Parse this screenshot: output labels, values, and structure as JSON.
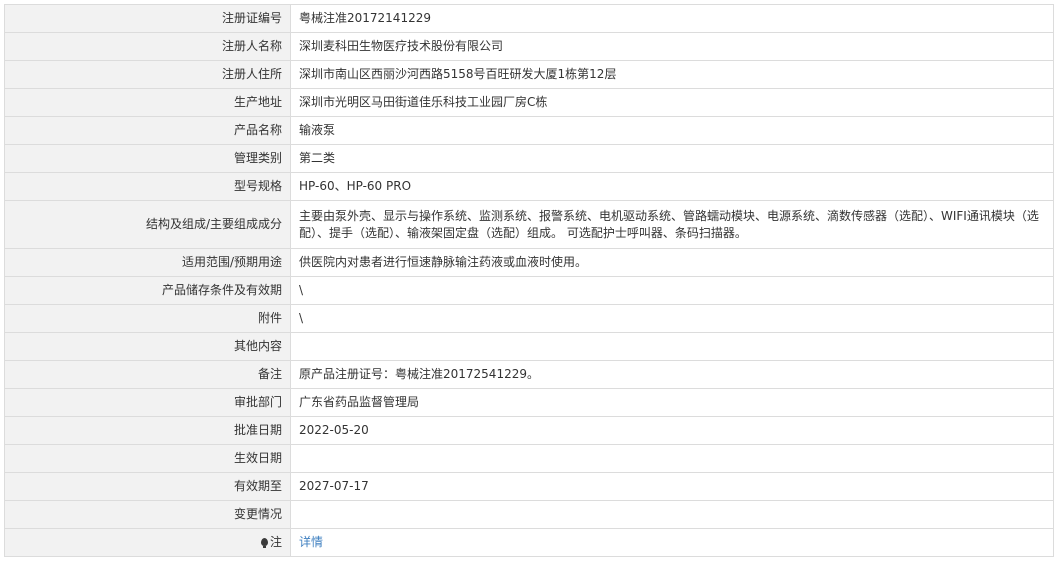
{
  "rows": [
    {
      "label": "注册证编号",
      "value": "粤械注准20172141229"
    },
    {
      "label": "注册人名称",
      "value": "深圳麦科田生物医疗技术股份有限公司"
    },
    {
      "label": "注册人住所",
      "value": "深圳市南山区西丽沙河西路5158号百旺研发大厦1栋第12层"
    },
    {
      "label": "生产地址",
      "value": "深圳市光明区马田街道佳乐科技工业园厂房C栋"
    },
    {
      "label": "产品名称",
      "value": "输液泵"
    },
    {
      "label": "管理类别",
      "value": "第二类"
    },
    {
      "label": "型号规格",
      "value": "HP-60、HP-60 PRO"
    },
    {
      "label": "结构及组成/主要组成成分",
      "value": "主要由泵外壳、显示与操作系统、监测系统、报警系统、电机驱动系统、管路蠕动模块、电源系统、滴数传感器（选配）、WIFI通讯模块（选配）、提手（选配）、输液架固定盘（选配）组成。 可选配护士呼叫器、条码扫描器。"
    },
    {
      "label": "适用范围/预期用途",
      "value": "供医院内对患者进行恒速静脉输注药液或血液时使用。"
    },
    {
      "label": "产品储存条件及有效期",
      "value": "\\"
    },
    {
      "label": "附件",
      "value": "\\"
    },
    {
      "label": "其他内容",
      "value": ""
    },
    {
      "label": "备注",
      "value": "原产品注册证号：粤械注准20172541229。"
    },
    {
      "label": "审批部门",
      "value": "广东省药品监督管理局"
    },
    {
      "label": "批准日期",
      "value": "2022-05-20"
    },
    {
      "label": "生效日期",
      "value": ""
    },
    {
      "label": "有效期至",
      "value": "2027-07-17"
    },
    {
      "label": "变更情况",
      "value": ""
    }
  ],
  "note": {
    "label": "注",
    "icon": "lightbulb-icon",
    "link_text": "详情",
    "link_color": "#3e7fc0"
  },
  "colors": {
    "label_bg": "#f2f2f2",
    "border": "#dcdcdc",
    "text": "#333333"
  }
}
